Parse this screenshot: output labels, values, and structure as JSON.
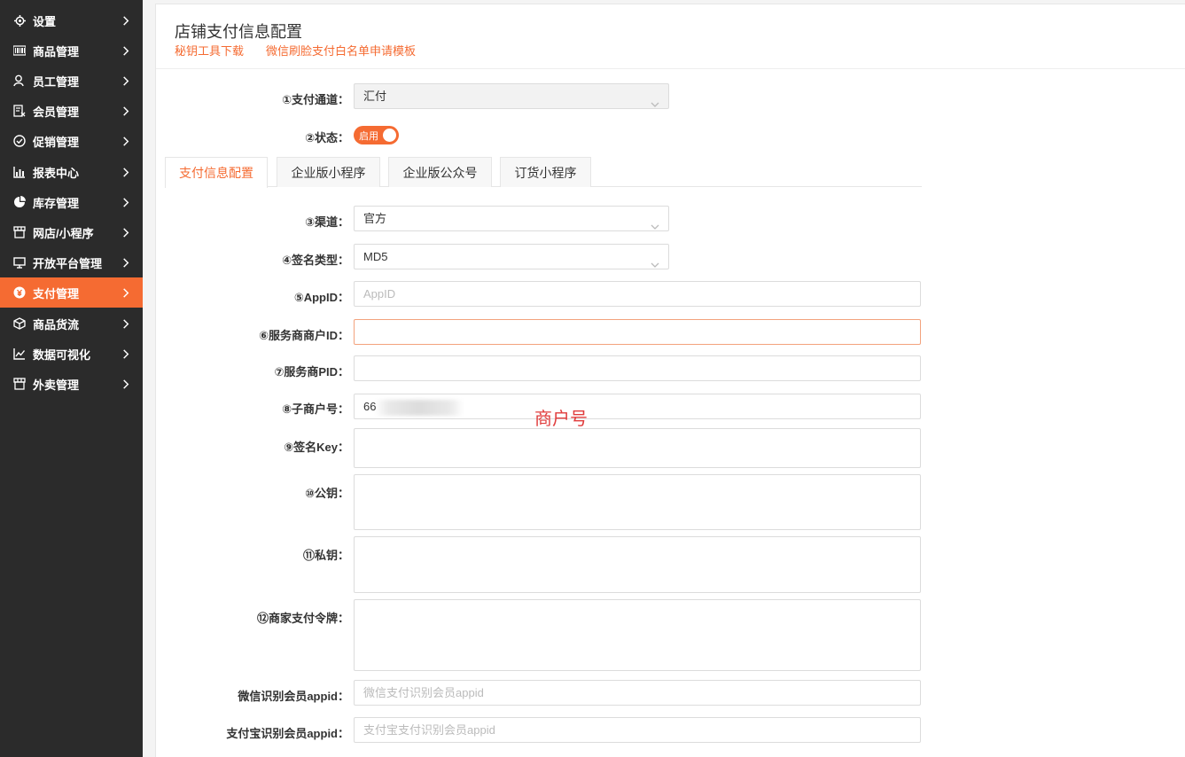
{
  "sidebar": {
    "items": [
      {
        "label": "设置",
        "icon": "gear-icon"
      },
      {
        "label": "商品管理",
        "icon": "barcode-icon"
      },
      {
        "label": "员工管理",
        "icon": "user-icon"
      },
      {
        "label": "会员管理",
        "icon": "member-card-icon"
      },
      {
        "label": "促销管理",
        "icon": "check-circle-icon"
      },
      {
        "label": "报表中心",
        "icon": "bar-chart-icon"
      },
      {
        "label": "库存管理",
        "icon": "pie-chart-icon"
      },
      {
        "label": "网店/小程序",
        "icon": "store-icon"
      },
      {
        "label": "开放平台管理",
        "icon": "monitor-icon"
      },
      {
        "label": "支付管理",
        "icon": "payment-icon",
        "active": true
      },
      {
        "label": "商品货流",
        "icon": "cube-icon"
      },
      {
        "label": "数据可视化",
        "icon": "line-chart-icon"
      },
      {
        "label": "外卖管理",
        "icon": "shop-icon"
      }
    ]
  },
  "header": {
    "title": "店铺支付信息配置",
    "link_key_tool": "秘钥工具下载",
    "link_wechat_template": "微信刷脸支付白名单申请模板"
  },
  "form": {
    "channel_label": "①支付通道：",
    "channel_value": "汇付",
    "status_label": "②状态：",
    "status_value": "启用",
    "route_label": "③渠道：",
    "route_value": "官方",
    "sign_type_label": "④签名类型：",
    "sign_type_value": "MD5",
    "appid_label": "⑤AppID：",
    "appid_placeholder": "AppID",
    "sp_merchant_label": "⑥服务商商户ID：",
    "sp_pid_label": "⑦服务商PID：",
    "sub_merchant_label": "⑧子商户号：",
    "sub_merchant_value": "66",
    "sign_key_label": "⑨签名Key：",
    "public_key_label": "⑩公钥：",
    "private_key_label": "⑪私钥：",
    "merchant_token_label": "⑫商家支付令牌：",
    "wechat_appid_label": "微信识别会员appid：",
    "wechat_appid_placeholder": "微信支付识别会员appid",
    "alipay_appid_label": "支付宝识别会员appid：",
    "alipay_appid_placeholder": "支付宝支付识别会员appid"
  },
  "tabs": [
    "支付信息配置",
    "企业版小程序",
    "企业版公众号",
    "订货小程序"
  ],
  "annotation": "商户号",
  "colors": {
    "accent": "#f56b32",
    "sidebar_bg": "#2b2b2b",
    "annotation": "#e03c3c"
  }
}
